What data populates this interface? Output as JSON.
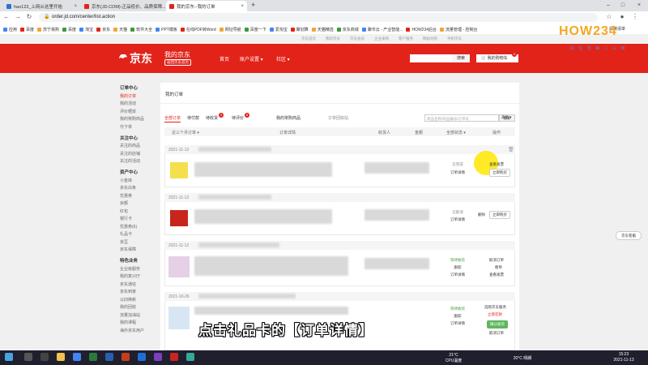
{
  "browser": {
    "tabs": [
      {
        "title": "hao123_上网从这里开始",
        "fav_color": "#2f6fd6"
      },
      {
        "title": "京东(JD.COM)-正品低价、品质保障...",
        "fav_color": "#e2231a"
      },
      {
        "title": "我的京东--我的订单",
        "fav_color": "#e2231a"
      }
    ],
    "new_tab": "+",
    "url": "order.jd.com/center/list.action",
    "bookmarks": [
      "应用",
      "百度",
      "苏宁易购",
      "百度",
      "淘宝",
      "京东",
      "天猫",
      "软件大全",
      "PPT模板",
      "在线PDF转Word",
      "网址导航",
      "百度一下",
      "爱淘宝",
      "聚划算",
      "天猫精选",
      "京东商城",
      "聚币云 - 产业智能...",
      "HOW234后台",
      "流量管理 - 控制台"
    ],
    "reading_list": "阅读清单"
  },
  "jd": {
    "top_links": [
      "京东首页",
      "我的京东",
      "京东会员",
      "企业采购",
      "客户服务",
      "网站导航",
      "手机京东"
    ],
    "logo": "京东",
    "my_jd": "我的京东",
    "back_home": "返回京东首页",
    "nav": [
      "首页",
      "账户设置 ▾",
      "社区 ▾"
    ],
    "search_btn": "搜索",
    "cart": "我的购物车",
    "cart_count": "0"
  },
  "left_nav": [
    {
      "heading": "订单中心",
      "items": [
        "我的订单",
        "我的活动",
        "评价晒单",
        "我的常购商品",
        "代下单"
      ]
    },
    {
      "heading": "关注中心",
      "items": [
        "关注的商品",
        "关注的店铺",
        "关注的活动"
      ]
    },
    {
      "heading": "资产中心",
      "items": [
        "小金库",
        "京东白条",
        "优惠券",
        "余额",
        "红包",
        "银行卡",
        "优惠券(6)",
        "礼品卡",
        "京豆",
        "京东保障"
      ]
    },
    {
      "heading": "特色业务",
      "items": [
        "企业级服务",
        "我的复兴厅",
        "京东通信",
        "京东到家",
        "以旧换新",
        "我的回收",
        "流量加油站",
        "我的课程",
        "海外京东用户"
      ]
    }
  ],
  "orders_page": {
    "title": "我的订单",
    "tabs": [
      {
        "label": "全部订单",
        "badge": ""
      },
      {
        "label": "待付款",
        "badge": ""
      },
      {
        "label": "待收货",
        "badge": "3"
      },
      {
        "label": "待评价",
        "badge": "8"
      }
    ],
    "often_bought": "我的常购商品",
    "recycle": "订单回收站",
    "search_placeholder": "商品名称/商品编号/订单号",
    "search_btn": "搜索",
    "advanced": "高级 ▾",
    "headers": [
      "近三个月订单 ▾",
      "订单详情",
      "收货人",
      "金额",
      "全部状态 ▾",
      "操作"
    ],
    "orders": [
      {
        "date": "2021-11-13",
        "status": [
          "已完成",
          "订单详情"
        ],
        "actions": [
          "查看发票",
          "立即购买"
        ],
        "thumb": "#f4e04d"
      },
      {
        "date": "2021-11-13",
        "status": [
          "已取消",
          "订单详情"
        ],
        "actions": [
          "删除",
          "立即购买"
        ],
        "thumb": "#c8261c"
      },
      {
        "date": "2021-11-12",
        "status": [
          "等待收货",
          "跟踪",
          "订单详情"
        ],
        "actions": [
          "取消订单",
          "催单",
          "查看发票"
        ],
        "thumb": "#e5d0e8"
      },
      {
        "date": "2021-10-26",
        "status": [
          "等待收货",
          "跟踪",
          "订单详情"
        ],
        "actions": [
          "选购京东服务",
          "立即还款",
          "确认收货",
          "取消订单"
        ],
        "thumb": "#d8e6f3"
      }
    ]
  },
  "caption": "点击礼品卡的【订单详情】",
  "watermark": "HOW234",
  "watermark_sub": "好 生 活 每 二 三 四",
  "helper": "京东客服",
  "taskbar": {
    "weather_temp": "21°C",
    "weather_label": "CPU温度",
    "weather2": "20°C 晴朗",
    "time": "15:23",
    "date": "2021-11-13"
  },
  "colors": {
    "jd_red": "#e2231a",
    "highlight": "#ffe600",
    "green_status": "#3c9a3c"
  }
}
